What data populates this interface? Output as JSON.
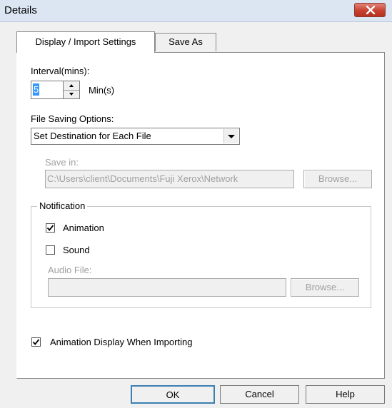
{
  "window": {
    "title": "Details"
  },
  "tabs": [
    {
      "label": "Display / Import Settings",
      "active": true
    },
    {
      "label": "Save As",
      "active": false
    }
  ],
  "interval": {
    "label": "Interval(mins):",
    "value": "5",
    "unit": "Min(s)"
  },
  "file_saving": {
    "label": "File Saving Options:",
    "selected": "Set Destination for Each File"
  },
  "save_in": {
    "label": "Save in:",
    "path": "C:\\Users\\client\\Documents\\Fuji Xerox\\Network",
    "browse_label": "Browse..."
  },
  "notification": {
    "legend": "Notification",
    "animation_label": "Animation",
    "animation_checked": true,
    "sound_label": "Sound",
    "sound_checked": false,
    "audio_file_label": "Audio File:",
    "audio_file_value": "",
    "browse_label": "Browse..."
  },
  "animation_import": {
    "label": "Animation Display When Importing",
    "checked": true
  },
  "footer": {
    "ok_label": "OK",
    "cancel_label": "Cancel",
    "help_label": "Help"
  },
  "icons": [
    "close-icon",
    "spin-up-icon",
    "spin-down-icon",
    "dropdown-arrow-icon",
    "checkmark-icon"
  ],
  "colors": {
    "titlebar": "#dce6f2",
    "close_button": "#c7412f",
    "selection": "#3399ff"
  }
}
